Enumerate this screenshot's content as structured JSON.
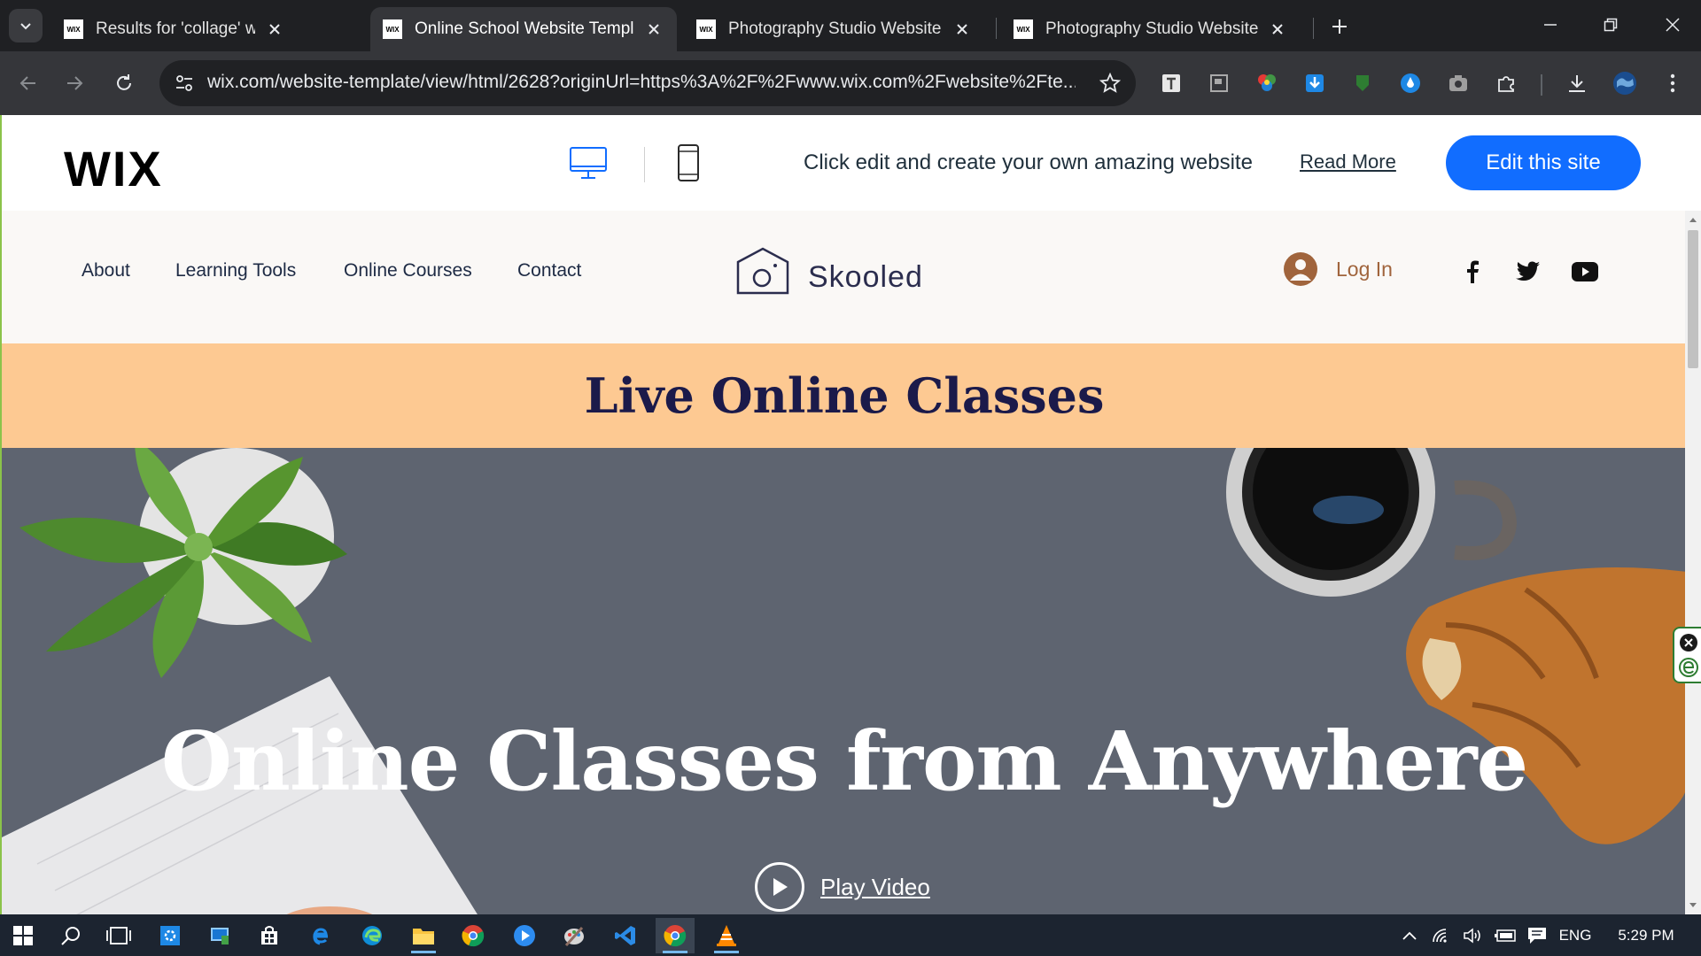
{
  "browser": {
    "tabs": [
      {
        "title": "Results for 'collage' website tem",
        "favicon": "WIX"
      },
      {
        "title": "Online School Website Templat",
        "favicon": "WIX"
      },
      {
        "title": "Photography Studio Website Te",
        "favicon": "WIX"
      },
      {
        "title": "Photography Studio Website Te",
        "favicon": "WIX"
      }
    ],
    "active_tab_index": 1,
    "url": "wix.com/website-template/view/html/2628?originUrl=https%3A%2F%2Fwww.wix.com%2Fwebsite%2Fte..."
  },
  "wix_bar": {
    "logo": "WIX",
    "promo": "Click edit and create your own amazing website",
    "read_more": "Read More",
    "edit_button": "Edit this site",
    "accent_color": "#116dff"
  },
  "site": {
    "menu": [
      "About",
      "Learning Tools",
      "Online Courses",
      "Contact"
    ],
    "logo_text": "Skooled",
    "login_label": "Log In",
    "social": [
      "facebook-icon",
      "twitter-icon",
      "youtube-icon"
    ],
    "banner_title": "Live Online Classes",
    "banner_color": "#fdc992",
    "hero_title": "Online Classes from Anywhere",
    "play_label": "Play Video"
  },
  "taskbar": {
    "language": "ENG",
    "time": "5:29 PM"
  }
}
